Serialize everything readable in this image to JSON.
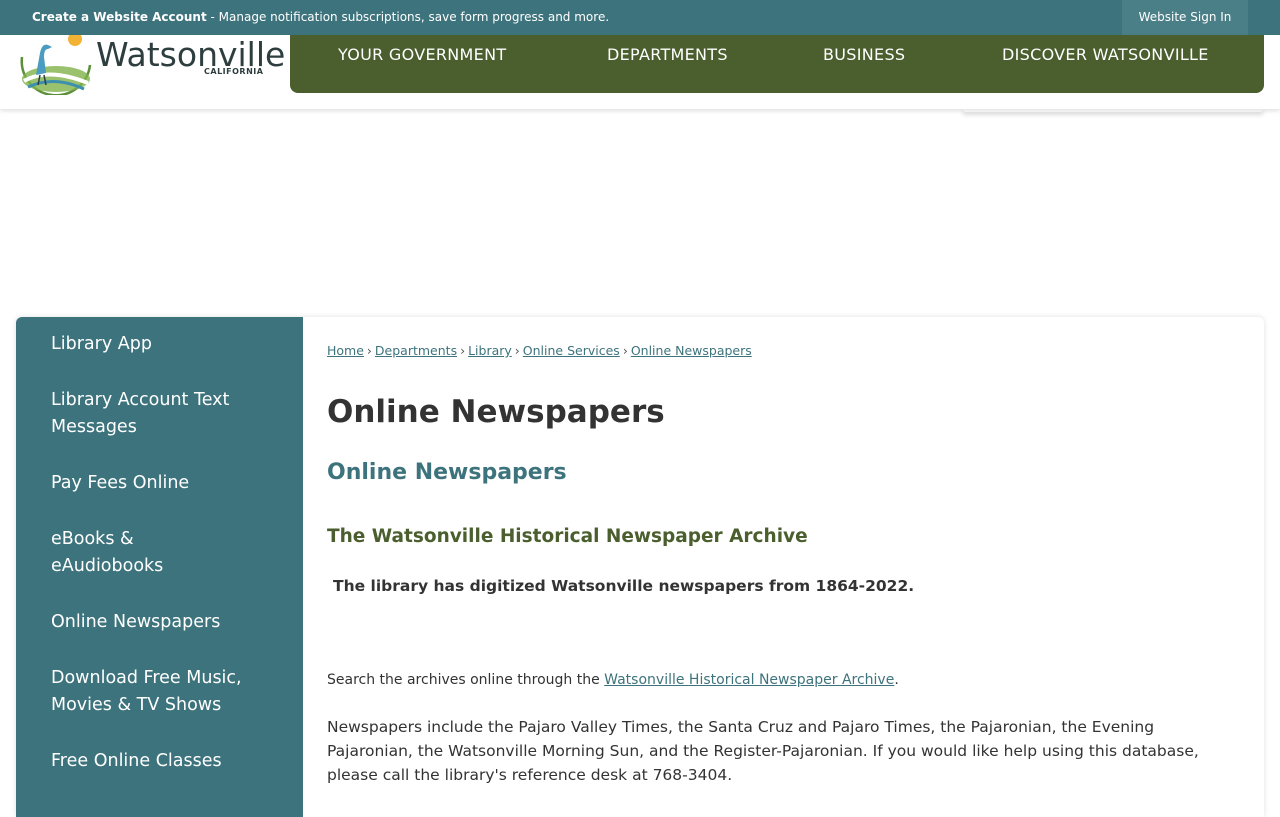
{
  "topbar": {
    "account_link": "Create a Website Account",
    "account_desc": " - Manage notification subscriptions, save form progress and more.",
    "signin": "Website Sign In"
  },
  "logo": {
    "name": "Watsonville",
    "sub": "CALIFORNIA"
  },
  "nav": {
    "items": [
      "YOUR GOVERNMENT",
      "DEPARTMENTS",
      "BUSINESS",
      "DISCOVER WATSONVILLE"
    ]
  },
  "sidebar": {
    "items": [
      "Library App",
      "Library Account Text Messages",
      "Pay Fees Online",
      "eBooks & eAudiobooks",
      "Online Newspapers",
      "Download Free Music, Movies & TV Shows",
      "Free Online Classes"
    ]
  },
  "breadcrumb": {
    "items": [
      "Home",
      "Departments",
      "Library",
      "Online Services",
      "Online Newspapers"
    ],
    "separator": "›"
  },
  "page": {
    "title": "Online Newspapers",
    "subtitle": "Online Newspapers",
    "section_title": "The Watsonville Historical Newspaper Archive",
    "lead": "The library has digitized Watsonville newspapers from 1864-2022.",
    "search_prefix": "Search the archives online through the ",
    "search_link": "Watsonville Historical Newspaper Archive",
    "search_suffix": ".",
    "body": "Newspapers include the Pajaro Valley Times, the Santa Cruz and Pajaro Times, the Pajaronian, the Evening Pajaronian, the Watsonville Morning Sun, and the Register-Pajaronian.  If you would like help using this database, please call the library's reference desk at 768-3404."
  },
  "colors": {
    "teal": "#3d737c",
    "olive": "#4a5e2e",
    "text": "#333333"
  }
}
